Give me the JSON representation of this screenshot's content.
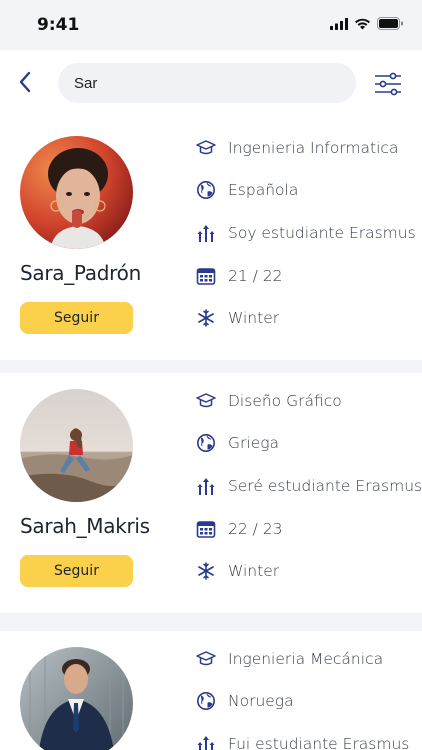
{
  "status_bar": {
    "time": "9:41"
  },
  "search": {
    "value": "Sar"
  },
  "accent_color": "#2a3a8c",
  "button_color": "#fbd04a",
  "results": [
    {
      "username": "Sara_Padrón",
      "follow_label": "Seguir",
      "study": "Ingenieria Informatica",
      "nationality": "Española",
      "erasmus_status": "Soy estudiante Erasmus",
      "year": "21 / 22",
      "season": "Winter"
    },
    {
      "username": "Sarah_Makris",
      "follow_label": "Seguir",
      "study": "Diseño Gráfico",
      "nationality": "Griega",
      "erasmus_status": "Seré estudiante Erasmus",
      "year": "22 / 23",
      "season": "Winter"
    },
    {
      "username": "",
      "follow_label": "",
      "study": "Ingenieria Mecánica",
      "nationality": "Noruega",
      "erasmus_status": "Fui estudiante Erasmus"
    }
  ],
  "icons": [
    "back-arrow-icon",
    "filter-sliders-icon",
    "graduation-cap-icon",
    "globe-icon",
    "erasmus-arrows-icon",
    "calendar-icon",
    "snowflake-icon"
  ]
}
